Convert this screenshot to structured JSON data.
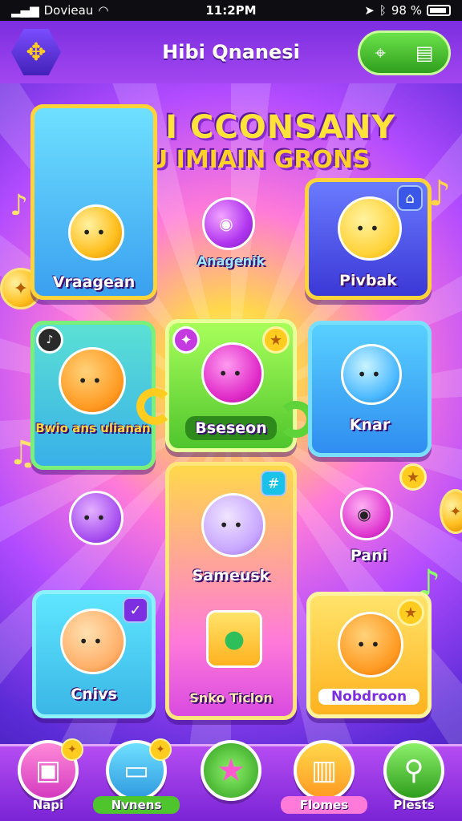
{
  "status_bar": {
    "carrier": "Dovieau",
    "time": "11:2PM",
    "battery": "98 %"
  },
  "header": {
    "title": "Hibi Qnanesi",
    "left_icon": "game-controller-icon",
    "right_icons": [
      "location-pin-icon",
      "shop-icon"
    ]
  },
  "banner": {
    "line1": "YOW I CCONSANY",
    "line2": "PROU IMIAIN GRONS"
  },
  "cards": [
    {
      "label": "Vraagean"
    },
    {
      "label": "Anagenik"
    },
    {
      "label": "Pivbak"
    },
    {
      "label": "Bwio ans ulianan"
    },
    {
      "label": "Bseseon"
    },
    {
      "label": "Knar"
    },
    {
      "label": "Sameusk"
    },
    {
      "label": "Pani"
    },
    {
      "label": "Cnivs"
    },
    {
      "label": "Snko Ticlon"
    },
    {
      "label": "Nobdroon"
    }
  ],
  "bottom_nav": [
    {
      "label": "Napi",
      "icon": "box-icon"
    },
    {
      "label": "Nvnens",
      "icon": "screen-icon"
    },
    {
      "label": "",
      "icon": "star-icon"
    },
    {
      "label": "Flomes",
      "icon": "cabinet-icon"
    },
    {
      "label": "Plests",
      "icon": "search-icon"
    }
  ],
  "colors": {
    "accent_purple": "#7c2ee0",
    "accent_yellow": "#ffd33a",
    "accent_green": "#4fc52d"
  }
}
